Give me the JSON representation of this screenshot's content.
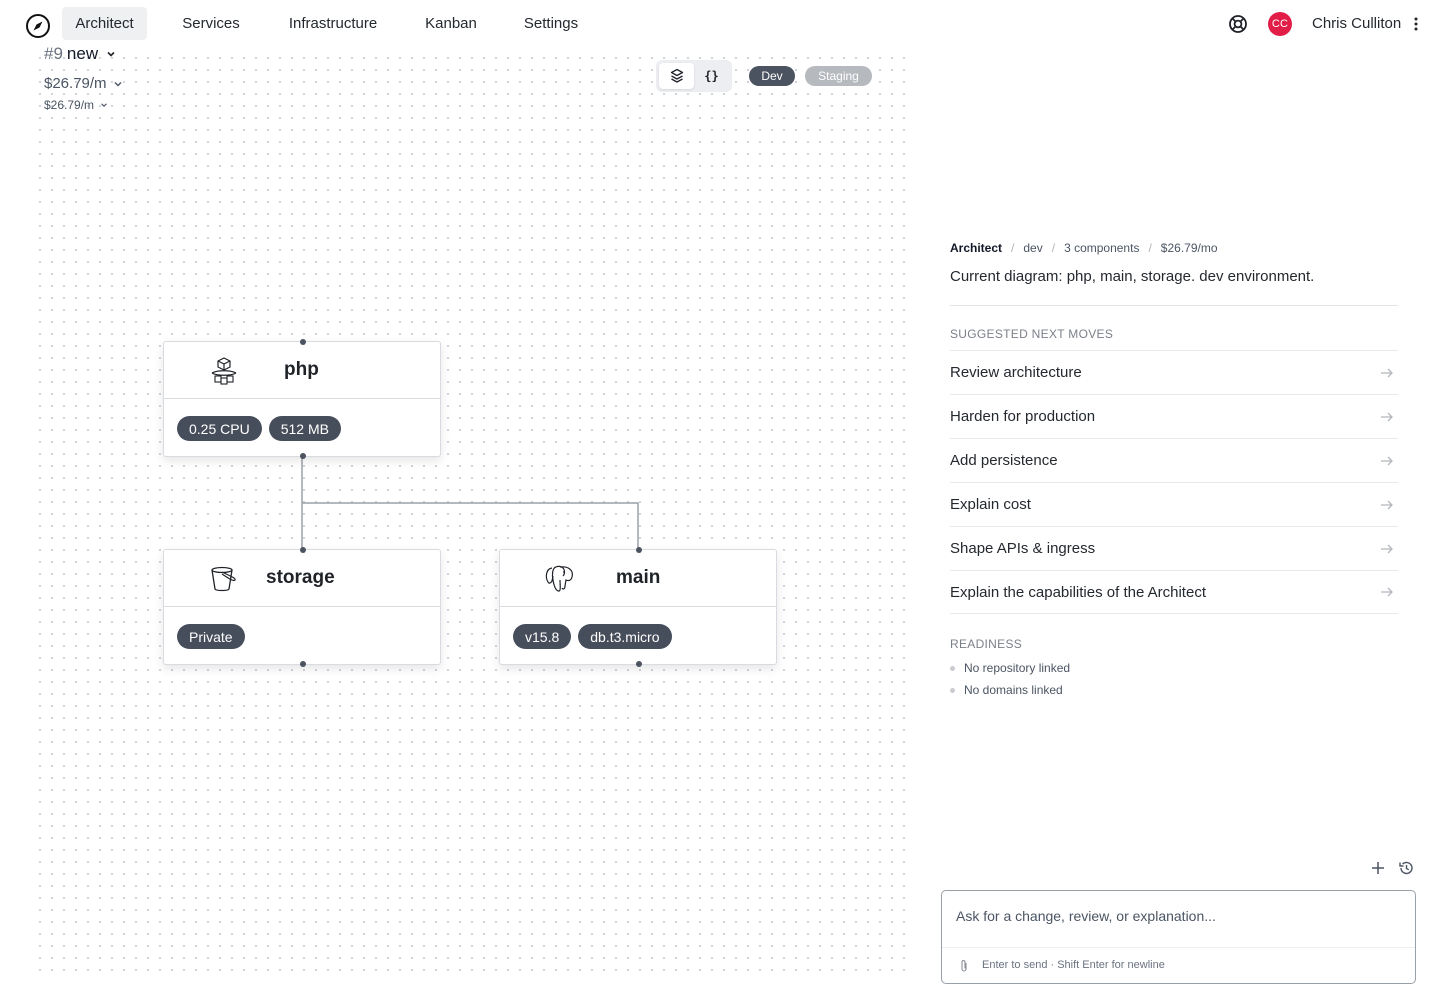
{
  "nav": {
    "tabs": [
      {
        "label": "Architect",
        "active": true
      },
      {
        "label": "Services",
        "active": false
      },
      {
        "label": "Infrastructure",
        "active": false
      },
      {
        "label": "Kanban",
        "active": false
      },
      {
        "label": "Settings",
        "active": false
      }
    ],
    "user": {
      "initials": "CC",
      "name": "Chris Culliton",
      "avatar_color": "#e11d48"
    },
    "icons": {
      "logo": "compass-icon",
      "help": "lifebuoy-icon",
      "more": "vertical-dots-icon"
    }
  },
  "project": {
    "number": "#9",
    "name": "new",
    "cost_primary": "$26.79/m",
    "cost_secondary": "$26.79/m"
  },
  "toolbar": {
    "views": [
      {
        "icon": "layers-icon",
        "active": true
      },
      {
        "label": "{}",
        "icon": "json-braces-icon",
        "active": false
      }
    ],
    "environments": [
      {
        "label": "Dev",
        "active": true,
        "color": "#4b5260"
      },
      {
        "label": "Staging",
        "active": false,
        "color": "#b6b9be"
      }
    ]
  },
  "diagram": {
    "nodes": [
      {
        "id": "php",
        "title": "php",
        "icon": "container-cluster-icon",
        "tags": [
          "0.25 CPU",
          "512 MB"
        ]
      },
      {
        "id": "storage",
        "title": "storage",
        "icon": "bucket-icon",
        "tags": [
          "Private"
        ]
      },
      {
        "id": "main",
        "title": "main",
        "icon": "postgres-elephant-icon",
        "tags": [
          "v15.8",
          "db.t3.micro"
        ]
      }
    ],
    "edges": [
      {
        "from": "php",
        "to": "storage"
      },
      {
        "from": "php",
        "to": "main"
      }
    ]
  },
  "panel": {
    "breadcrumb": [
      "Architect",
      "dev",
      "3 components",
      "$26.79/mo"
    ],
    "summary": "Current diagram: php, main, storage. dev environment.",
    "suggested_title": "SUGGESTED NEXT MOVES",
    "moves": [
      "Review architecture",
      "Harden for production",
      "Add persistence",
      "Explain cost",
      "Shape APIs & ingress",
      "Explain the capabilities of the Architect"
    ],
    "readiness_title": "READINESS",
    "readiness": [
      "No repository linked",
      "No domains linked"
    ]
  },
  "chat": {
    "placeholder": "Ask for a change, review, or explanation...",
    "hint": "Enter to send · Shift Enter for newline",
    "icons": {
      "new": "plus-icon",
      "history": "history-icon",
      "attach": "paperclip-icon"
    }
  }
}
